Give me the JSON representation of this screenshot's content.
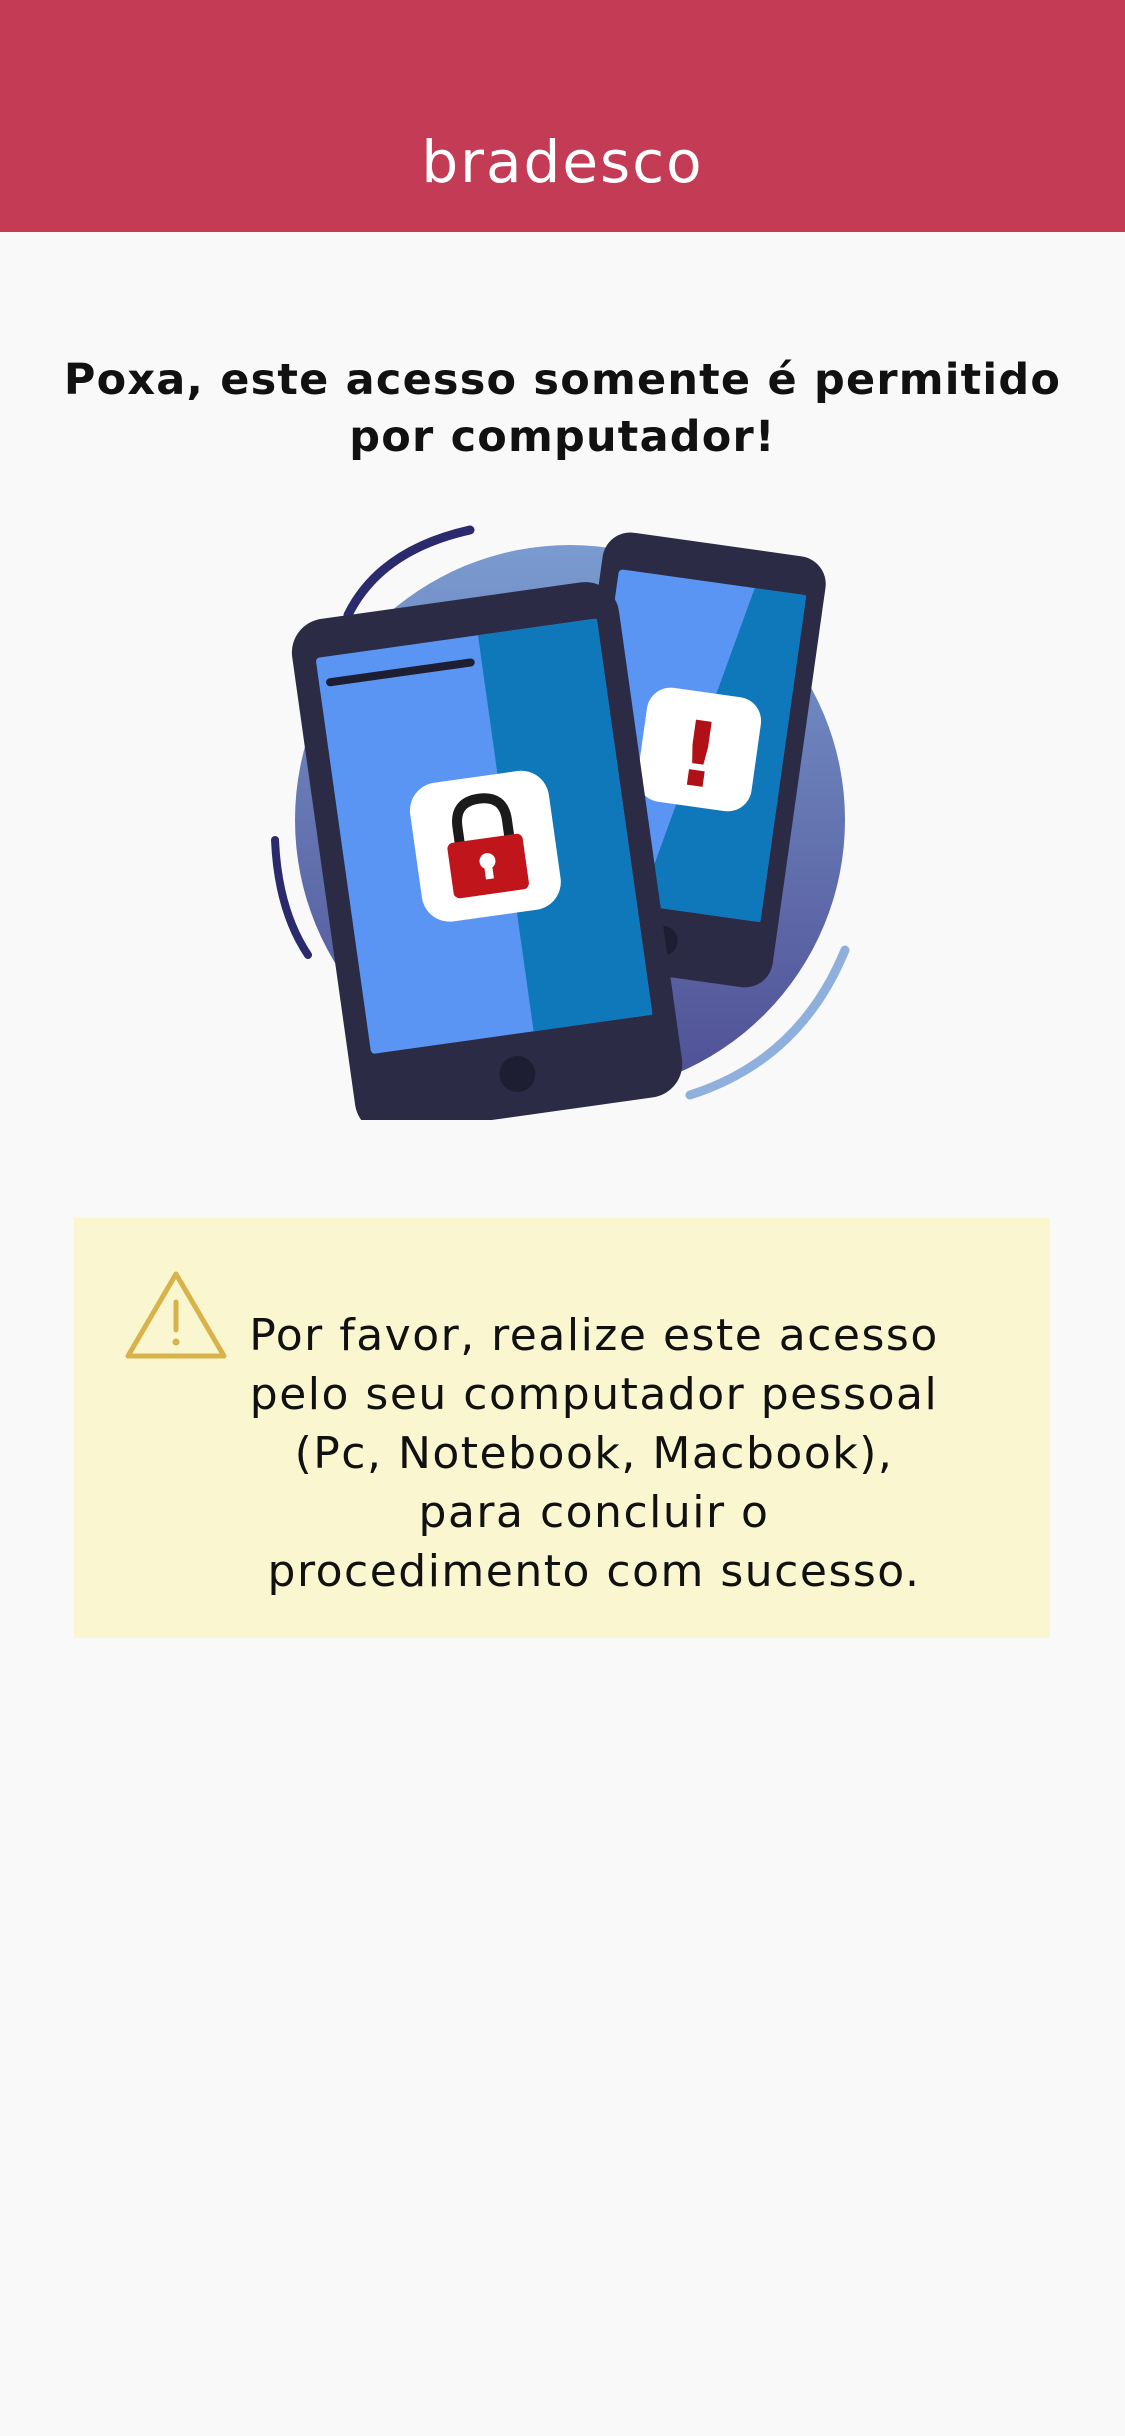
{
  "header": {
    "brand": "bradesco",
    "background_color": "#c33b55"
  },
  "main": {
    "headline": "Poxa, este acesso somente é permitido\npor computador!",
    "illustration": {
      "icons": [
        "smartphone-lock-icon",
        "smartphone-alert-icon"
      ],
      "alert_symbol": "!"
    },
    "notice": {
      "icon": "warning-triangle-icon",
      "text": "Por favor, realize este acesso\npelo seu computador  pessoal\n(Pc, Notebook, Macbook),\npara concluir o\nprocedimento com sucesso.",
      "background_color": "#f9f6d0"
    }
  }
}
